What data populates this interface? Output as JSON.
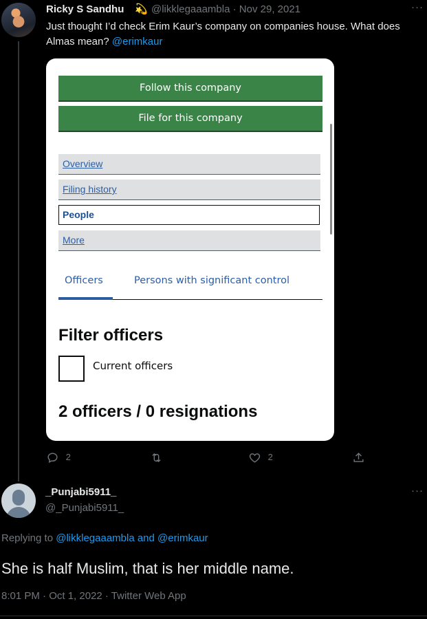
{
  "tweet": {
    "author_name": "Ricky S Sandhu",
    "author_emoji": "💫",
    "author_handle": "@likklegaaambla",
    "separator": "·",
    "date": "Nov 29, 2021",
    "more_label": "···",
    "text": "Just thought I’d check Erim Kaur’s company on companies house. What does Almas mean? ",
    "mention": "@erimkaur",
    "embedded_page": {
      "buttons": [
        "Follow this company",
        "File for this company"
      ],
      "nav": [
        {
          "label": "Overview",
          "active": false
        },
        {
          "label": "Filing history",
          "active": false
        },
        {
          "label": "People",
          "active": true
        },
        {
          "label": "More",
          "active": false
        }
      ],
      "tabs": [
        {
          "label": "Officers",
          "active": true
        },
        {
          "label": "Persons with significant control",
          "active": false
        }
      ],
      "filter_heading": "Filter officers",
      "checkbox_label": "Current officers",
      "checkbox_checked": false,
      "count_heading": "2 officers / 0 resignations"
    },
    "actions": {
      "replies": "2",
      "retweets": "",
      "likes": "2"
    }
  },
  "reply": {
    "author_name": "_Punjabi5911_",
    "author_handle": "@_Punjabi5911_",
    "more_label": "···",
    "replying_prefix": "Replying to ",
    "replying_to_1": "@likklegaaambla",
    "replying_and": " and ",
    "replying_to_2": "@erimkaur",
    "text": "She is half Muslim, that is her middle name.",
    "timestamp": "8:01 PM · Oct 1, 2022 · Twitter Web App"
  },
  "colors": {
    "background": "#000000",
    "link_blue": "#1d9bf0",
    "muted": "#71767b",
    "govuk_green": "#3b8448",
    "govuk_link": "#2a5ea7"
  }
}
